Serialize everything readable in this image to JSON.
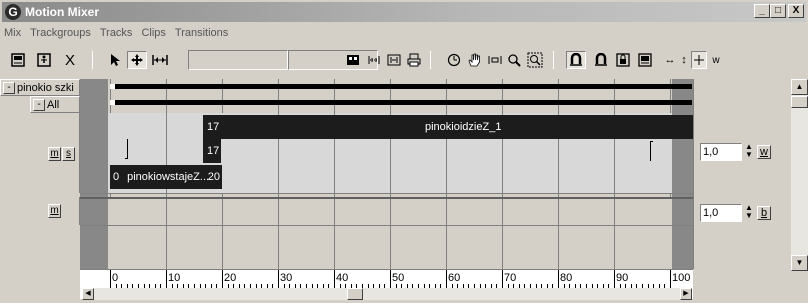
{
  "window": {
    "title": "Motion Mixer",
    "buttons": {
      "minimize": "_",
      "maximize": "□",
      "close": "X"
    }
  },
  "menu": [
    "Mix",
    "Trackgroups",
    "Tracks",
    "Clips",
    "Transitions"
  ],
  "toolbar": {
    "close_glyph": "X",
    "reserve_label": "w",
    "icons": [
      "mixer-panel-icon",
      "biped-icon",
      "delete-icon",
      "select-icon",
      "move-icon",
      "scale-icon",
      "layer-icon",
      "time-warp-icon",
      "range-icon",
      "print-icon",
      "clock-icon",
      "pan-icon",
      "fit-range-icon",
      "zoom-icon",
      "zoom-region-icon",
      "snap-frames-icon",
      "snap-clips-icon",
      "lock-icon",
      "reserve-icon",
      "horizontal-arrows-icon",
      "vertical-arrows-icon",
      "move-box-icon"
    ]
  },
  "trackgroups": [
    {
      "label": "pinokio szki",
      "collapse": "-"
    },
    {
      "label": "All",
      "collapse": "-"
    }
  ],
  "track_buttons": {
    "m": "m",
    "s": "s"
  },
  "tracks": [
    {
      "clips": [
        {
          "start": "17",
          "name": "pinokioidzieZ_1"
        },
        {
          "start": "17",
          "name": ""
        },
        {
          "start": "0",
          "name": "pinokiowstajeZ...",
          "end": "20"
        }
      ],
      "weight": "1,0",
      "weight_button": "w"
    },
    {
      "clips": [],
      "weight": "1,0",
      "weight_button": "b"
    }
  ],
  "ruler": {
    "ticks": [
      "0",
      "10",
      "20",
      "30",
      "40",
      "50",
      "60",
      "70",
      "80",
      "90",
      "100"
    ]
  }
}
